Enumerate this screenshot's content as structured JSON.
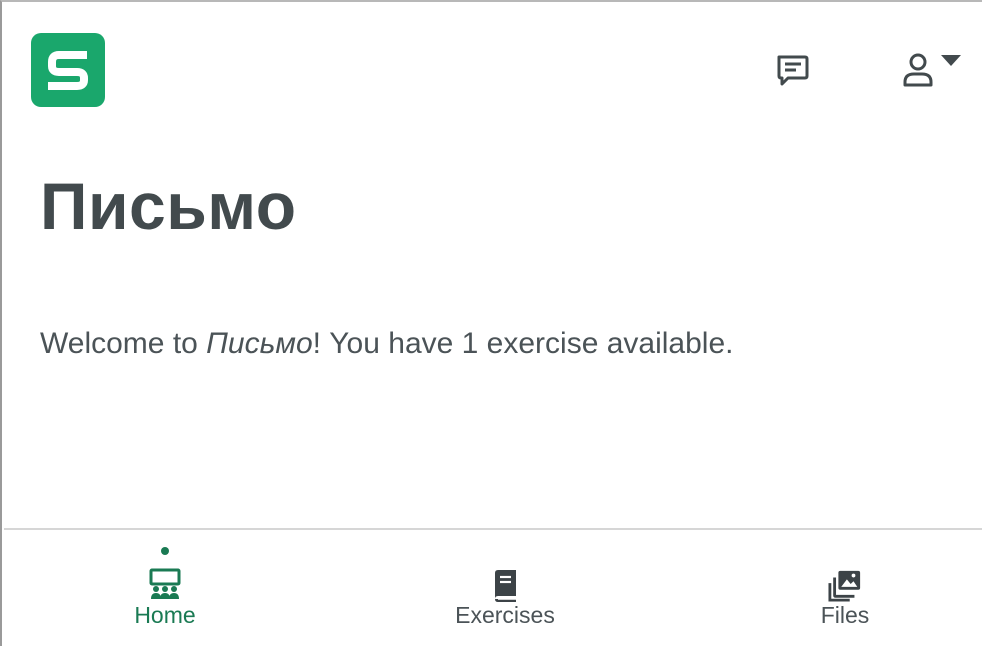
{
  "app": {
    "logo_letter": "S",
    "brand_color": "#1aa76c"
  },
  "header": {
    "icons": [
      "feedback-icon",
      "account-icon",
      "caret-down-icon"
    ]
  },
  "page": {
    "title": "Письмо",
    "welcome_prefix": "Welcome to ",
    "welcome_course": "Письмо",
    "welcome_suffix": "! You have 1 exercise available."
  },
  "bottom_nav": {
    "active_color": "#1a7a53",
    "items": [
      {
        "label": "Home",
        "icon": "classroom-icon",
        "active": true
      },
      {
        "label": "Exercises",
        "icon": "book-icon",
        "active": false
      },
      {
        "label": "Files",
        "icon": "images-icon",
        "active": false
      }
    ]
  }
}
